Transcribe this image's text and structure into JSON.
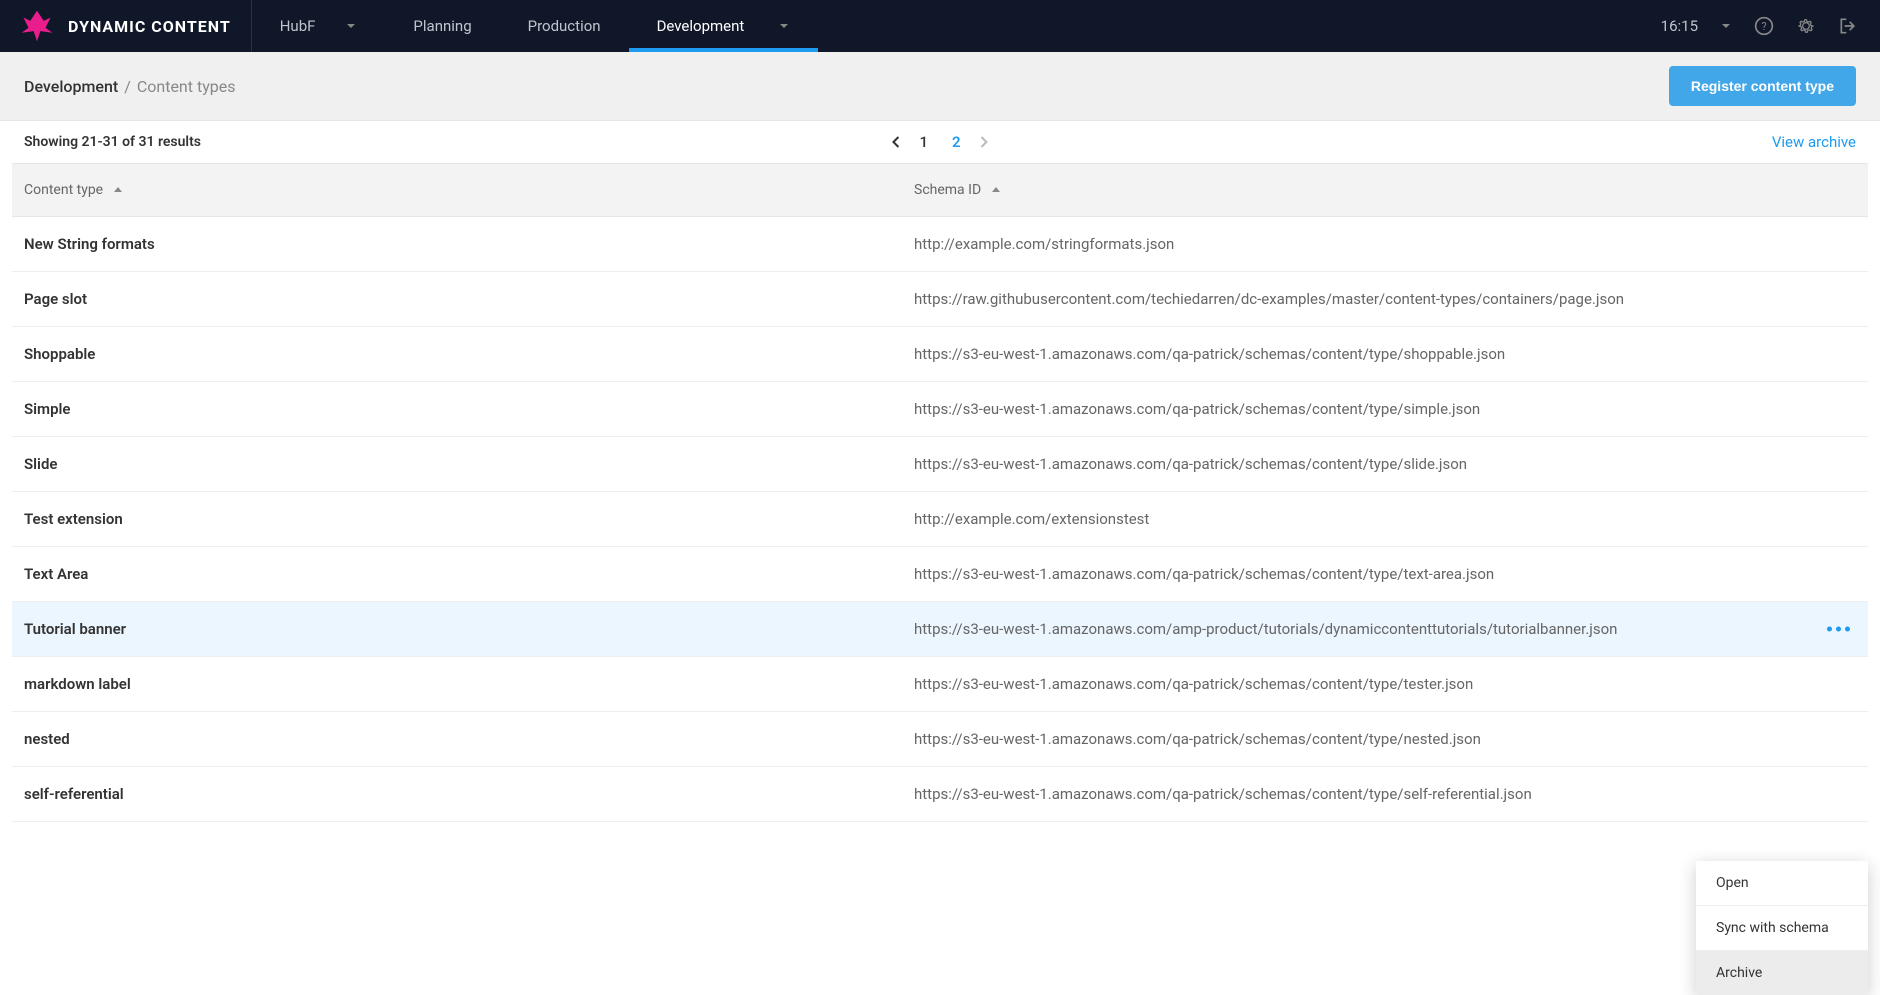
{
  "header": {
    "brand": "DYNAMIC CONTENT",
    "hub": "HubF",
    "tabs": [
      "Planning",
      "Production",
      "Development"
    ],
    "active_tab": "Development",
    "time": "16:15"
  },
  "breadcrumb": {
    "root": "Development",
    "current": "Content types",
    "register_btn": "Register content type"
  },
  "results": {
    "showing": "Showing 21-31 of 31 results",
    "pages": [
      "1",
      "2"
    ],
    "active_page": "2",
    "view_archive": "View archive"
  },
  "columns": {
    "type": "Content type",
    "schema": "Schema ID"
  },
  "rows": [
    {
      "name": "New String formats",
      "schema": "http://example.com/stringformats.json"
    },
    {
      "name": "Page slot",
      "schema": "https://raw.githubusercontent.com/techiedarren/dc-examples/master/content-types/containers/page.json"
    },
    {
      "name": "Shoppable",
      "schema": "https://s3-eu-west-1.amazonaws.com/qa-patrick/schemas/content/type/shoppable.json"
    },
    {
      "name": "Simple",
      "schema": "https://s3-eu-west-1.amazonaws.com/qa-patrick/schemas/content/type/simple.json"
    },
    {
      "name": "Slide",
      "schema": "https://s3-eu-west-1.amazonaws.com/qa-patrick/schemas/content/type/slide.json"
    },
    {
      "name": "Test extension",
      "schema": "http://example.com/extensionstest"
    },
    {
      "name": "Text Area",
      "schema": "https://s3-eu-west-1.amazonaws.com/qa-patrick/schemas/content/type/text-area.json"
    },
    {
      "name": "Tutorial banner",
      "schema": "https://s3-eu-west-1.amazonaws.com/amp-product/tutorials/dynamiccontenttutorials/tutorialbanner.json",
      "selected": true,
      "show_actions": true
    },
    {
      "name": "markdown label",
      "schema": "https://s3-eu-west-1.amazonaws.com/qa-patrick/schemas/content/type/tester.json"
    },
    {
      "name": "nested",
      "schema": "https://s3-eu-west-1.amazonaws.com/qa-patrick/schemas/content/type/nested.json"
    },
    {
      "name": "self-referential",
      "schema": "https://s3-eu-west-1.amazonaws.com/qa-patrick/schemas/content/type/self-referential.json"
    }
  ],
  "context_menu": {
    "items": [
      "Open",
      "Sync with schema",
      "Archive"
    ],
    "hover": "Archive"
  }
}
